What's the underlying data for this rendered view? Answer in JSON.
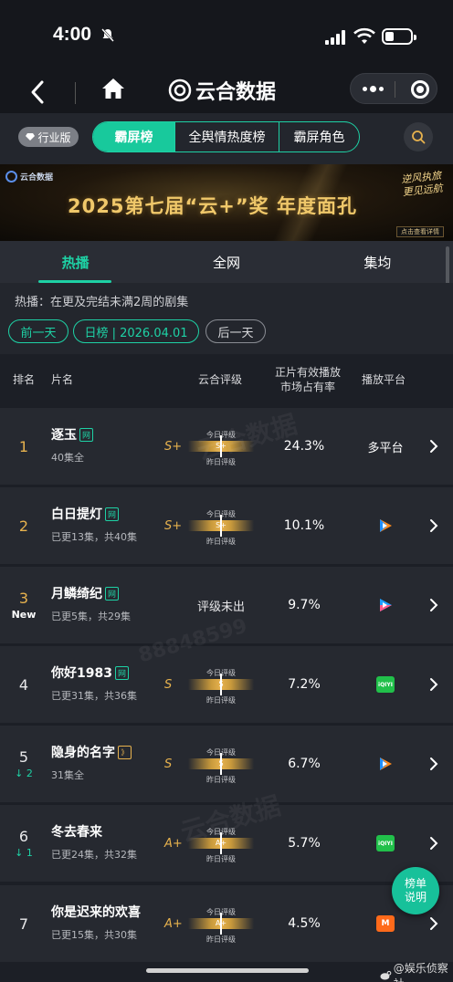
{
  "status": {
    "time": "4:00"
  },
  "nav": {
    "brand": "云合数据"
  },
  "toolbar": {
    "edition": "行业版",
    "tabs": [
      "霸屏榜",
      "全舆情热度榜",
      "霸屏角色"
    ]
  },
  "banner": {
    "logo_text": "云合数据",
    "title": "2025第七届“云+”奖  年度面孔",
    "script_line1": "逆风执旅",
    "script_line2": "更见远航",
    "cta": "点击查看详情"
  },
  "tabs": [
    "热播",
    "全网",
    "集均"
  ],
  "filter": {
    "description": "热播：在更及完结未满2周的剧集",
    "prev": "前一天",
    "date": "日榜 | 2026.04.01",
    "next": "后一天"
  },
  "columns": {
    "rank": "排名",
    "title": "片名",
    "grade": "云合评级",
    "share": "正片有效播放\n市场占有率",
    "platform": "播放平台"
  },
  "meter_labels": {
    "today": "今日评级",
    "yesterday": "昨日评级"
  },
  "rows": [
    {
      "rank": "1",
      "title": "逐玉",
      "badge": "网",
      "sub": "40集全",
      "grade": "S+",
      "meter": "S+",
      "share": "24.3%",
      "platform": "多平台"
    },
    {
      "rank": "2",
      "title": "白日提灯",
      "badge": "网",
      "sub": "已更13集，共40集",
      "grade": "S+",
      "meter": "S+",
      "share": "10.1%",
      "platform": ""
    },
    {
      "rank": "3",
      "tag": "New",
      "title": "月鳞绮纪",
      "badge": "网",
      "sub": "已更5集，共29集",
      "grade": "",
      "none": "评级未出",
      "share": "9.7%",
      "platform": ""
    },
    {
      "rank": "4",
      "title": "你好1983",
      "badge": "网",
      "sub": "已更31集，共36集",
      "grade": "S",
      "meter": "S",
      "share": "7.2%",
      "platform": ""
    },
    {
      "rank": "5",
      "down": "↓ 2",
      "title": "隐身的名字",
      "badge": "》",
      "sub": "31集全",
      "grade": "S",
      "meter": "S",
      "share": "6.7%",
      "platform": ""
    },
    {
      "rank": "6",
      "down": "↓ 1",
      "title": "冬去春来",
      "sub": "已更24集，共32集",
      "grade": "A+",
      "meter": "A+",
      "share": "5.7%",
      "platform": ""
    },
    {
      "rank": "7",
      "title": "你是迟来的欢喜",
      "sub": "已更15集，共30集",
      "grade": "A+",
      "meter": "A+",
      "share": "4.5%",
      "platform": ""
    }
  ],
  "platform_icons": {
    "iqiyi": "iQIYI",
    "mgtv": "M"
  },
  "fab": {
    "line1": "榜单",
    "line2": "说明"
  },
  "weibo": "@娱乐侦察社",
  "watermark": "云合数据",
  "watermark_id": "88848599",
  "colors": {
    "accent": "#1ed1a5",
    "gold": "#e7b24e",
    "background": "#1c1f26",
    "row": "#262930"
  }
}
